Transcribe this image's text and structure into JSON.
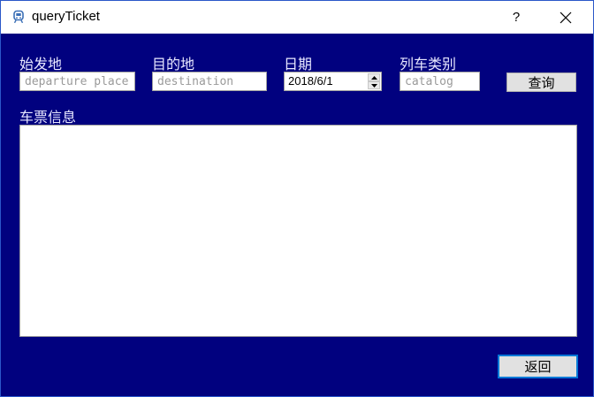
{
  "window": {
    "title": "queryTicket",
    "help_label": "?",
    "close_icon": "close-icon",
    "app_icon": "train-icon"
  },
  "form": {
    "departure": {
      "label": "始发地",
      "placeholder": "departure place",
      "value": ""
    },
    "destination": {
      "label": "目的地",
      "placeholder": "destination",
      "value": ""
    },
    "date": {
      "label": "日期",
      "value": "2018/6/1"
    },
    "catalog": {
      "label": "列车类别",
      "placeholder": "catalog",
      "value": ""
    },
    "query_button": "查询"
  },
  "results": {
    "label": "车票信息",
    "content": ""
  },
  "footer": {
    "back_button": "返回"
  },
  "colors": {
    "background": "#01017f",
    "label_text": "#e8e8ff",
    "focus_border": "#0078d7"
  }
}
